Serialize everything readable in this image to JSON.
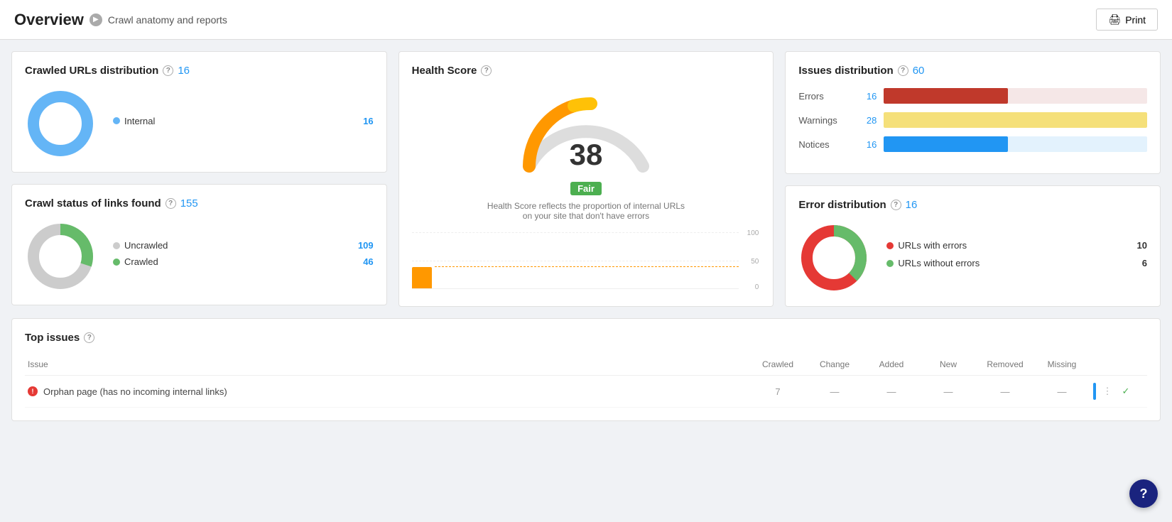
{
  "header": {
    "title": "Overview",
    "breadcrumb": "Crawl anatomy and reports",
    "print_label": "Print"
  },
  "crawled_urls": {
    "title": "Crawled URLs distribution",
    "count": "16",
    "legend": [
      {
        "label": "Internal",
        "color": "#64B5F6",
        "value": "16"
      }
    ]
  },
  "crawl_status": {
    "title": "Crawl status of links found",
    "count": "155",
    "legend": [
      {
        "label": "Uncrawled",
        "color": "#ccc",
        "value": "109"
      },
      {
        "label": "Crawled",
        "color": "#66BB6A",
        "value": "46"
      }
    ]
  },
  "health_score": {
    "title": "Health Score",
    "score": "38",
    "badge": "Fair",
    "description": "Health Score reflects the proportion of internal URLs on your site that don't have errors",
    "chart_labels": [
      "100",
      "50",
      "0"
    ]
  },
  "issues_distribution": {
    "title": "Issues distribution",
    "count": "60",
    "rows": [
      {
        "label": "Errors",
        "count": "16",
        "color": "#c0392b",
        "fill_pct": 47
      },
      {
        "label": "Warnings",
        "count": "28",
        "color": "#f5e07a",
        "fill_pct": 100
      },
      {
        "label": "Notices",
        "count": "16",
        "color": "#2196F3",
        "fill_pct": 47
      }
    ]
  },
  "error_distribution": {
    "title": "Error distribution",
    "count": "16",
    "legend": [
      {
        "label": "URLs with errors",
        "color": "#e53935",
        "value": "10"
      },
      {
        "label": "URLs without errors",
        "color": "#66BB6A",
        "value": "6"
      }
    ]
  },
  "top_issues": {
    "title": "Top issues",
    "columns": [
      "Issue",
      "Crawled",
      "Change",
      "Added",
      "New",
      "Removed",
      "Missing"
    ],
    "rows": [
      {
        "name": "Orphan page (has no incoming internal links)",
        "crawled": "7",
        "change": "—",
        "added": "—",
        "new": "—",
        "removed": "—",
        "missing": "—"
      }
    ]
  }
}
